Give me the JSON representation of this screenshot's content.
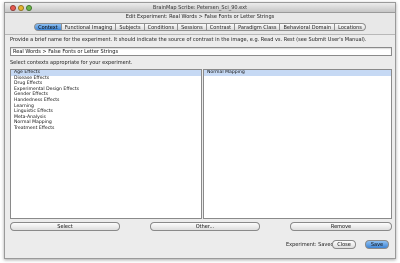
{
  "window": {
    "title": "BrainMap Scribe: Petersen_Sci_90.ext",
    "subtitle": "Edit Experiment: Real Words > False Fonts or Letter Strings"
  },
  "tabs": [
    {
      "label": "Context",
      "active": true
    },
    {
      "label": "Functional Imaging",
      "active": false
    },
    {
      "label": "Subjects",
      "active": false
    },
    {
      "label": "Conditions",
      "active": false
    },
    {
      "label": "Sessions",
      "active": false
    },
    {
      "label": "Contrast",
      "active": false
    },
    {
      "label": "Paradigm Class",
      "active": false
    },
    {
      "label": "Behavioral Domain",
      "active": false
    },
    {
      "label": "Locations",
      "active": false
    }
  ],
  "context": {
    "name_instructions": "Provide a brief name for the experiment. It should indicate the source of contrast in the image, e.g. Read vs. Rest (see Submit User's Manual).",
    "experiment_name": "Real Words > False Fonts or Letter Strings",
    "select_instructions": "Select contexts appropriate for your experiment.",
    "available_contexts": [
      "Age Effects",
      "Disease Effects",
      "Drug Effects",
      "Experimental Design Effects",
      "Gender Effects",
      "Handedness Effects",
      "Learning",
      "Linguistic Effects",
      "Meta-Analysis",
      "Normal Mapping",
      "Treatment Effects"
    ],
    "selected_contexts": [
      "Normal Mapping"
    ]
  },
  "buttons": {
    "select": "Select",
    "other": "Other...",
    "remove": "Remove",
    "close": "Close",
    "save": "Save"
  },
  "status": {
    "label": "Experiment:",
    "value": "Saved"
  }
}
